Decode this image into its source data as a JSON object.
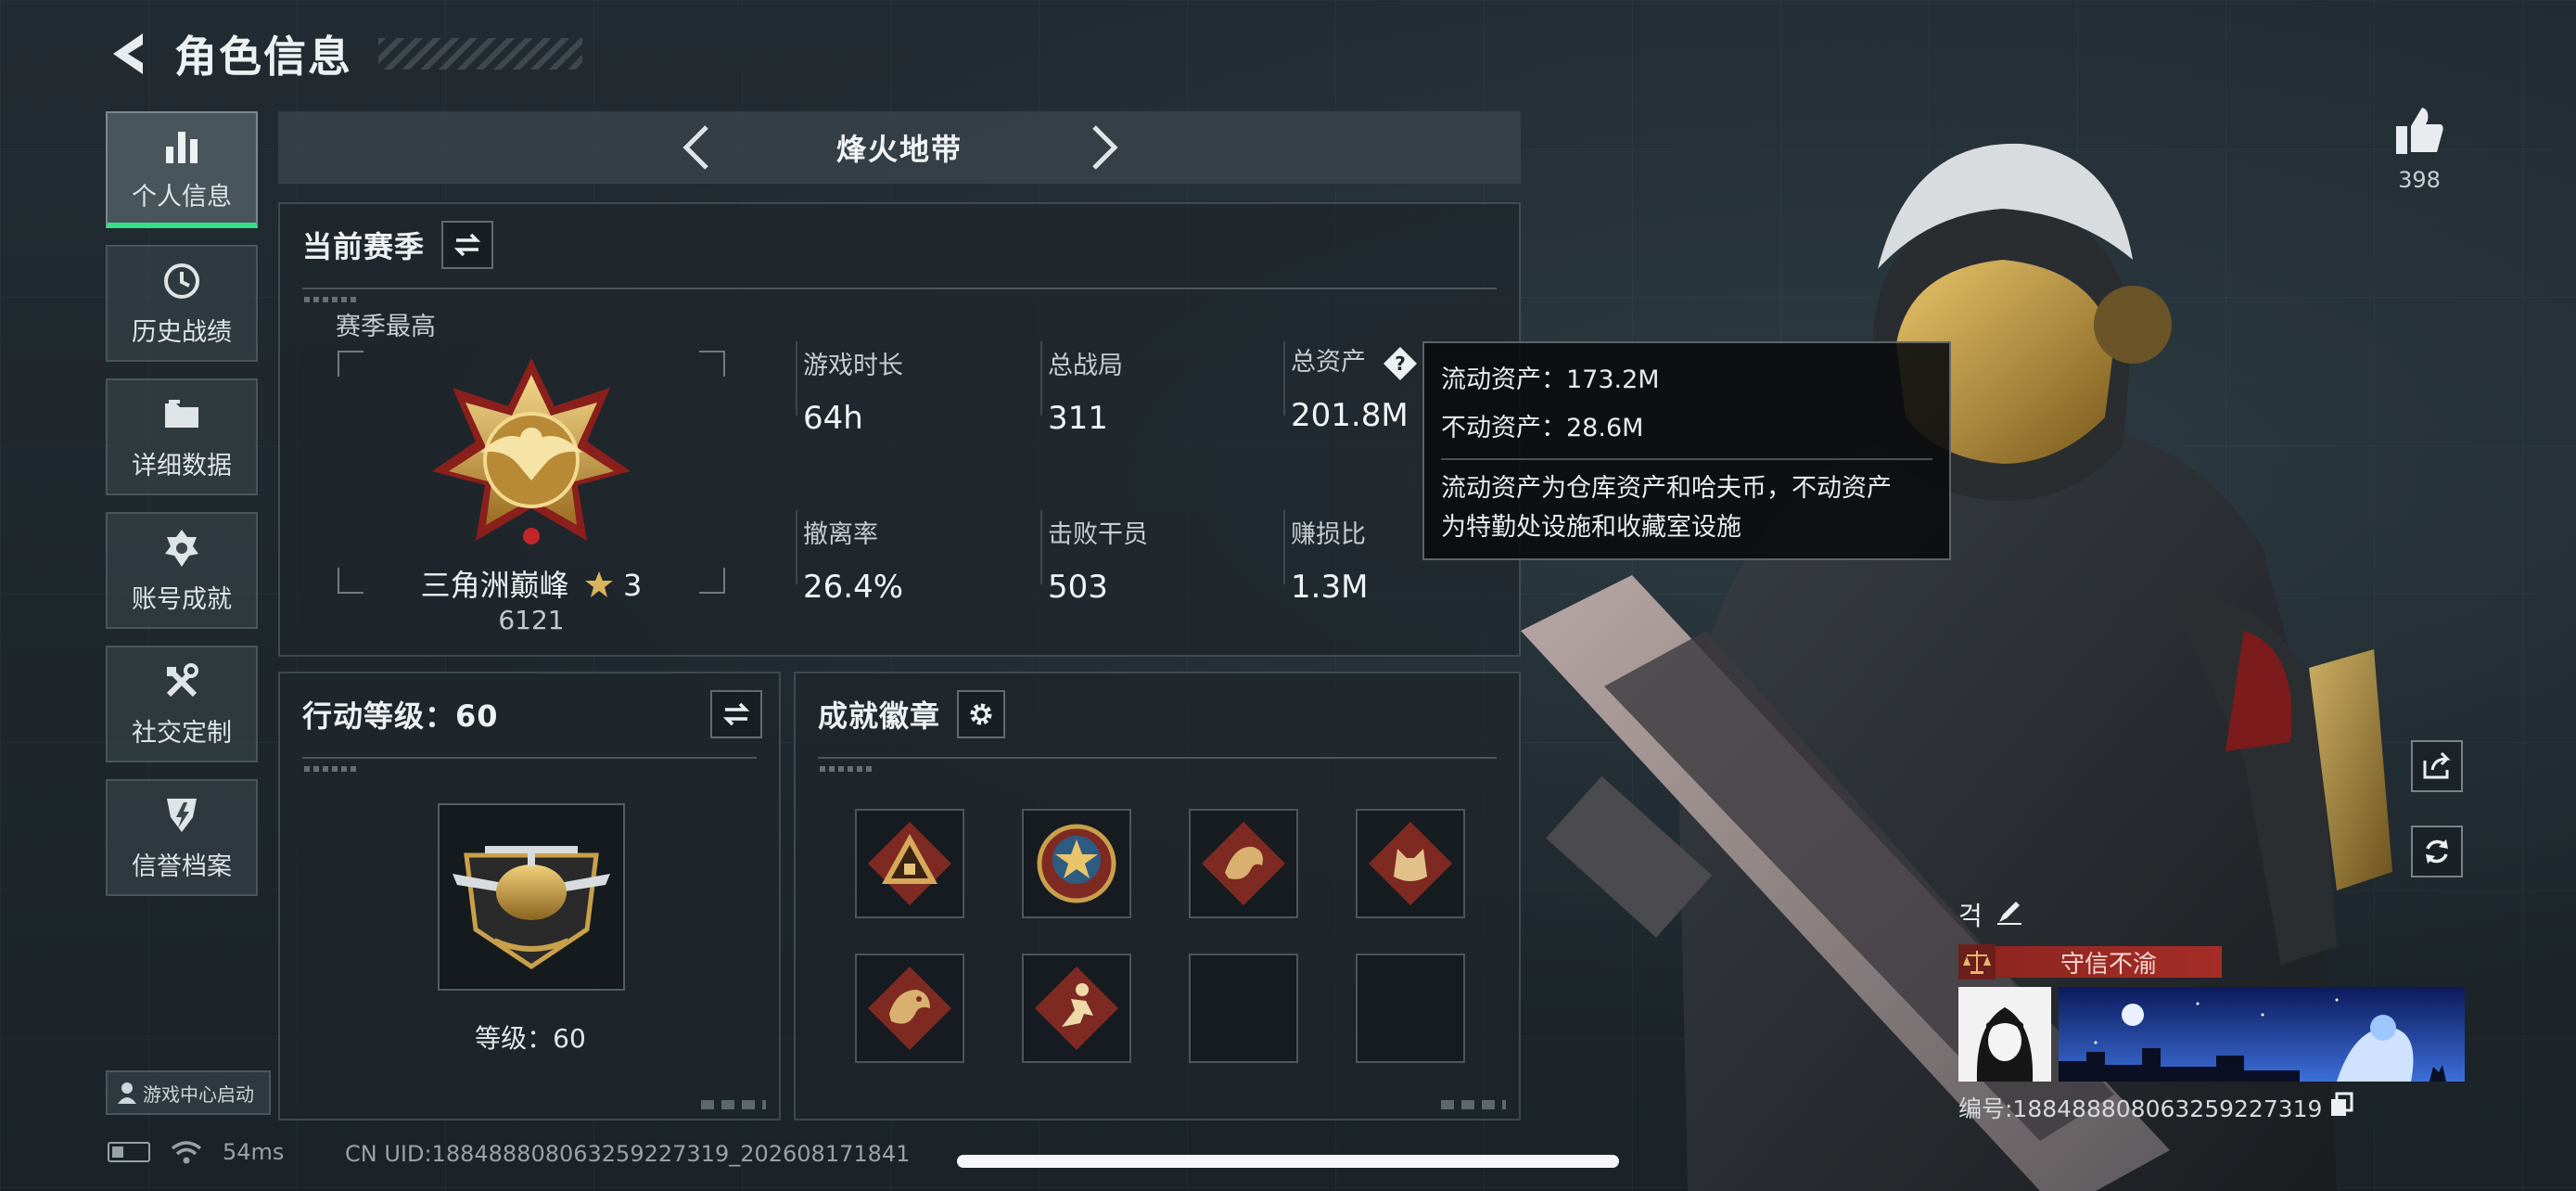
{
  "header": {
    "title": "角色信息"
  },
  "nav": [
    {
      "label": "个人信息",
      "icon": "bar-chart-icon",
      "active": true
    },
    {
      "label": "历史战绩",
      "icon": "history-icon"
    },
    {
      "label": "详细数据",
      "icon": "folder-icon"
    },
    {
      "label": "账号成就",
      "icon": "achievement-icon"
    },
    {
      "label": "社交定制",
      "icon": "tools-icon"
    },
    {
      "label": "信誉档案",
      "icon": "credit-icon"
    }
  ],
  "game_center": "游戏中心启动",
  "mode": {
    "title": "烽火地带"
  },
  "season": {
    "title": "当前赛季",
    "sub": "赛季最高",
    "rank_name": "三角洲巅峰",
    "rank_stars": "3",
    "rank_score": "6121",
    "stats": [
      {
        "label": "游戏时长",
        "value": "64h"
      },
      {
        "label": "总战局",
        "value": "311"
      },
      {
        "label": "总资产",
        "value": "201.8M"
      },
      {
        "label": "撤离率",
        "value": "26.4%"
      },
      {
        "label": "击败干员",
        "value": "503"
      },
      {
        "label": "赚损比",
        "value": "1.3M"
      }
    ]
  },
  "tooltip": {
    "liquid": "流动资产：173.2M",
    "fixed": "不动资产：28.6M",
    "desc_1": "流动资产为仓库资产和哈夫币，不动资产",
    "desc_2": "为特勤处设施和收藏室设施"
  },
  "level": {
    "title": "行动等级：60",
    "label": "等级：60"
  },
  "badges": {
    "title": "成就徽章"
  },
  "likes": "398",
  "player": {
    "name": "걱",
    "motto": "守信不渝",
    "uid": "编号:188488808063259227319"
  },
  "status": {
    "latency": "54ms"
  },
  "uid_line": "CN UID:188488808063259227319_202608171841",
  "colors": {
    "accent": "#36e08a",
    "motto_red": "#a52d27",
    "gold": "#c9a04a"
  }
}
